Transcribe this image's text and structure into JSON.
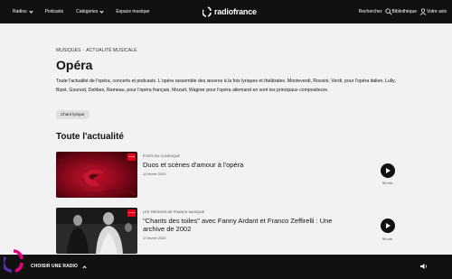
{
  "nav": {
    "radios": "Radios",
    "podcasts": "Podcasts",
    "categories": "Catégories",
    "music_space": "Espace musique",
    "brand": "radiofrance",
    "search": "Rechercher",
    "library": "Bibliothèque",
    "your_opinion": "Votre avis"
  },
  "breadcrumb": {
    "first": "MUSIQUES",
    "separator": "-",
    "second": "ACTUALITÉ MUSICALE"
  },
  "page": {
    "title": "Opéra",
    "description": "Toute l'actualité de l'opéra, concerts et podcasts. L'opéra rassemble des œuvres à la fois lyriques et théâtrales. Monteverdi, Rossini, Verdi, pour l'opéra italien, Lully, Bizet, Gounod, Delibes, Rameau, pour l'opéra français, Mozart, Wagner pour l'opéra allemand en sont les principaux compositeurs.",
    "tag": "Chant lyrique"
  },
  "section": {
    "title": "Toute l'actualité"
  },
  "articles": [
    {
      "meta": "ÉTATS DU CLASSIQUE",
      "title": "Duos et scènes d'amour à l'opéra",
      "date": "14 février 2023",
      "duration": "59 min",
      "badge": "musique"
    },
    {
      "meta": "LES TRÉSORS DE FRANCE MUSIQUE",
      "title": "\"Chants des toiles\" avec Fanny Ardant et Franco Zeffirelli : Une archive de 2002",
      "date": "17 février 2023",
      "duration": "59 min",
      "badge": "musique"
    }
  ],
  "player": {
    "choose_radio": "CHOISIR UNE RADIO"
  },
  "colors": {
    "nav_bg": "#111111",
    "page_bg": "#f2f2f2",
    "accent_red": "#e2001a",
    "logo_pink": "#e6007e",
    "logo_purple": "#5a2ea6"
  },
  "icons": {
    "search": "search-icon",
    "library": "user-icon",
    "play": "play-icon",
    "volume": "volume-icon"
  }
}
